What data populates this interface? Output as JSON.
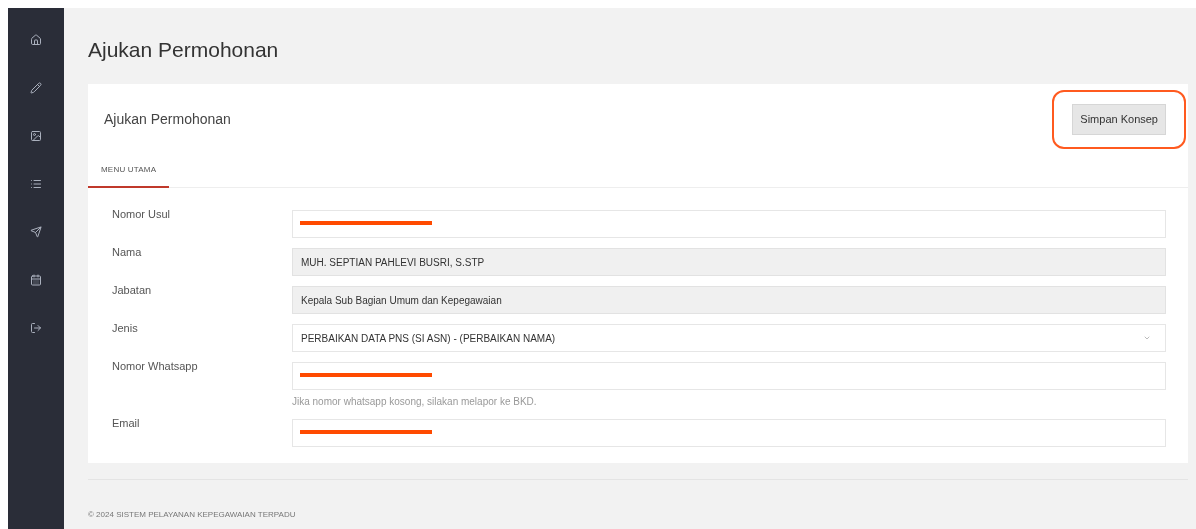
{
  "page_title": "Ajukan Permohonan",
  "sidebar": {
    "items": [
      {
        "kind": "home"
      },
      {
        "kind": "edit"
      },
      {
        "kind": "image"
      },
      {
        "kind": "list"
      },
      {
        "kind": "send"
      },
      {
        "kind": "calendar"
      },
      {
        "kind": "logout"
      }
    ]
  },
  "card": {
    "title": "Ajukan Permohonan",
    "save_button": {
      "label": "Simpan Konsep",
      "highlighted": true
    },
    "tabs": [
      {
        "label": "MENU UTAMA",
        "selected": true
      }
    ],
    "fields": [
      {
        "label": "Nomor Usul",
        "kind": "input",
        "redacted": true,
        "readonly": false
      },
      {
        "label": "Nama",
        "kind": "input",
        "value": "MUH. SEPTIAN PAHLEVI BUSRI, S.STP",
        "readonly": true
      },
      {
        "label": "Jabatan",
        "kind": "input",
        "value": "Kepala Sub Bagian Umum dan Kepegawaian",
        "readonly": true
      },
      {
        "label": "Jenis",
        "kind": "select",
        "value": "PERBAIKAN DATA PNS (SI ASN) - (PERBAIKAN NAMA)",
        "readonly": false
      },
      {
        "label": "Nomor Whatsapp",
        "kind": "input",
        "redacted": true,
        "readonly": false,
        "help": "Jika nomor whatsapp kosong, silakan melapor ke BKD."
      },
      {
        "label": "Email",
        "kind": "input",
        "redacted": true,
        "readonly": false
      }
    ]
  },
  "footer": "© 2024 SISTEM PELAYANAN KEPEGAWAIAN TERPADU"
}
